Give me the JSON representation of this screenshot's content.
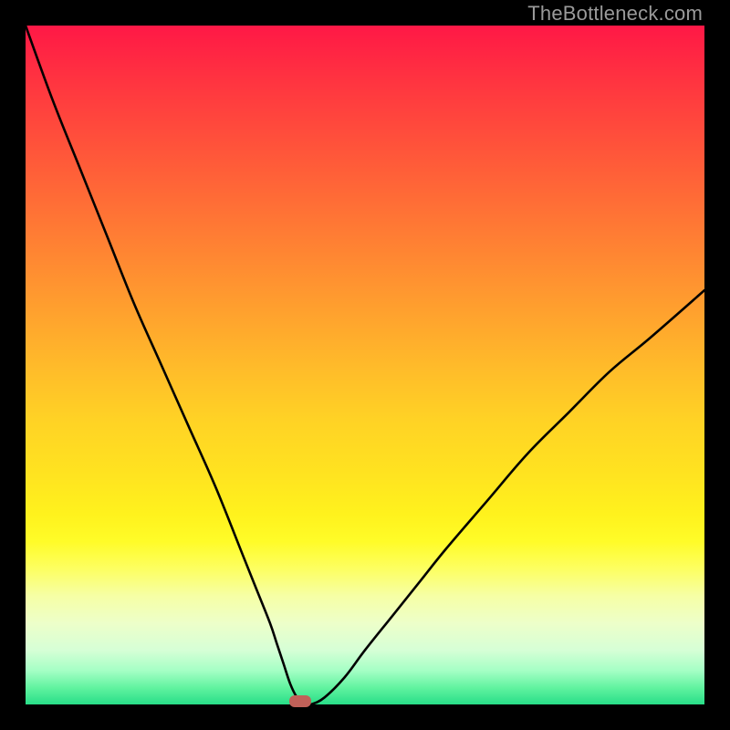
{
  "watermark": {
    "text": "TheBottleneck.com"
  },
  "colors": {
    "frame": "#000000",
    "curve_stroke": "#000000",
    "marker_fill": "#c06058",
    "gradient_top": "#ff1846",
    "gradient_bottom": "#28de88"
  },
  "chart_data": {
    "type": "line",
    "title": "",
    "xlabel": "",
    "ylabel": "",
    "xlim": [
      0,
      100
    ],
    "ylim": [
      0,
      100
    ],
    "grid": false,
    "series": [
      {
        "name": "bottleneck-curve",
        "x": [
          0,
          4,
          8,
          12,
          16,
          20,
          24,
          28,
          32,
          34,
          36,
          37,
          38,
          39,
          40,
          41,
          42,
          44,
          47,
          50,
          54,
          58,
          62,
          68,
          74,
          80,
          86,
          92,
          100
        ],
        "y": [
          100,
          89,
          79,
          69,
          59,
          50,
          41,
          32,
          22,
          17,
          12,
          9,
          6,
          3,
          1,
          0,
          0,
          1,
          4,
          8,
          13,
          18,
          23,
          30,
          37,
          43,
          49,
          54,
          61
        ]
      }
    ],
    "markers": [
      {
        "name": "optimal-point",
        "x": 40.5,
        "y": 0
      }
    ],
    "legend": false
  }
}
